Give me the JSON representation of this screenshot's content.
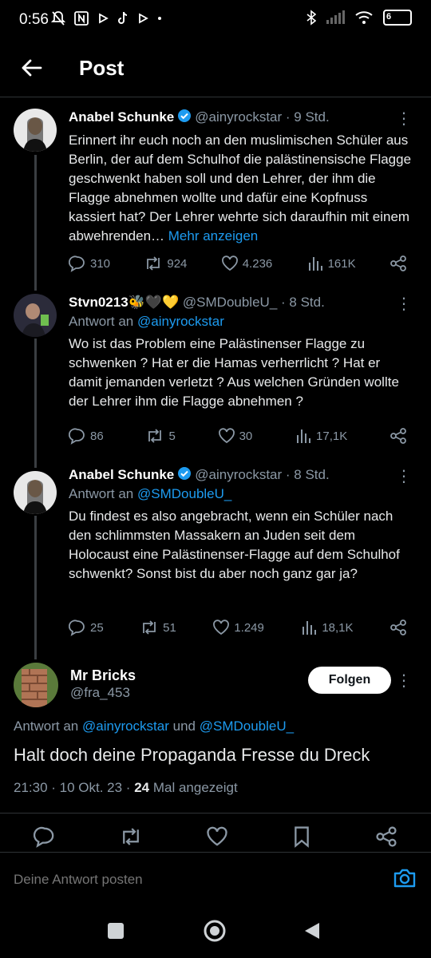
{
  "status_bar": {
    "time": "0:56",
    "battery": "6",
    "icons": [
      "mute-bell-icon",
      "nfc-icon",
      "play-icon",
      "tiktok-icon",
      "play-icon",
      "dot-icon",
      "bluetooth-icon",
      "signal-icon",
      "wifi-icon",
      "battery-icon"
    ]
  },
  "header": {
    "title": "Post",
    "back_icon": "back-arrow-icon"
  },
  "thread": [
    {
      "name": "Anabel Schunke",
      "verified": true,
      "handle": "@ainyrockstar",
      "time": "· 9 Std.",
      "reply_prefix": "",
      "reply_to": "",
      "text": "Erinnert ihr euch noch an den muslimischen Schüler aus Berlin, der auf dem Schulhof die palästinensische Flagge geschwenkt haben soll und den Lehrer, der ihm die Flagge abnehmen wollte und dafür eine Kopfnuss kassiert hat? Der Lehrer wehrte sich daraufhin mit einem abwehrenden…",
      "more": "Mehr anzeigen",
      "replies": "310",
      "reposts": "924",
      "likes": "4.236",
      "views": "161K"
    },
    {
      "name": "Stvn0213🐝🖤💛",
      "verified": false,
      "handle": "@SMDoubleU_",
      "time": "· 8 Std.",
      "reply_prefix": "Antwort an ",
      "reply_to": "@ainyrockstar",
      "text": "Wo ist das Problem eine Palästinenser Flagge zu schwenken ? Hat er die Hamas verherrlicht ? Hat er damit jemanden verletzt ? Aus welchen Gründen wollte der Lehrer ihm die Flagge abnehmen ?",
      "more": "",
      "replies": "86",
      "reposts": "5",
      "likes": "30",
      "views": "17,1K"
    },
    {
      "name": "Anabel Schunke",
      "verified": true,
      "handle": "@ainyrockstar",
      "time": "· 8 Std.",
      "reply_prefix": "Antwort an ",
      "reply_to": "@SMDoubleU_",
      "text": "Du findest es also angebracht, wenn ein Schüler nach den schlimmsten Massakern an Juden seit dem Holocaust eine Palästinenser-Flagge auf dem Schulhof schwenkt? Sonst bist du aber noch ganz gar ja?",
      "more": "",
      "replies": "25",
      "reposts": "51",
      "likes": "1.249",
      "views": "18,1K"
    }
  ],
  "main_post": {
    "name": "Mr Bricks",
    "handle": "@fra_453",
    "follow_label": "Folgen",
    "reply_prefix": "Antwort an ",
    "reply_to_1": "@ainyrockstar",
    "reply_and": " und ",
    "reply_to_2": "@SMDoubleU_",
    "text": "Halt doch deine Propaganda Fresse du Dreck",
    "timestamp": "21:30 · 10 Okt. 23 · ",
    "views_count": "24",
    "views_label": " Mal angezeigt"
  },
  "reply_bar": {
    "placeholder": "Deine Antwort posten"
  },
  "colors": {
    "accent": "#1d9bf0",
    "background": "#000000",
    "muted": "#8b98a5"
  }
}
